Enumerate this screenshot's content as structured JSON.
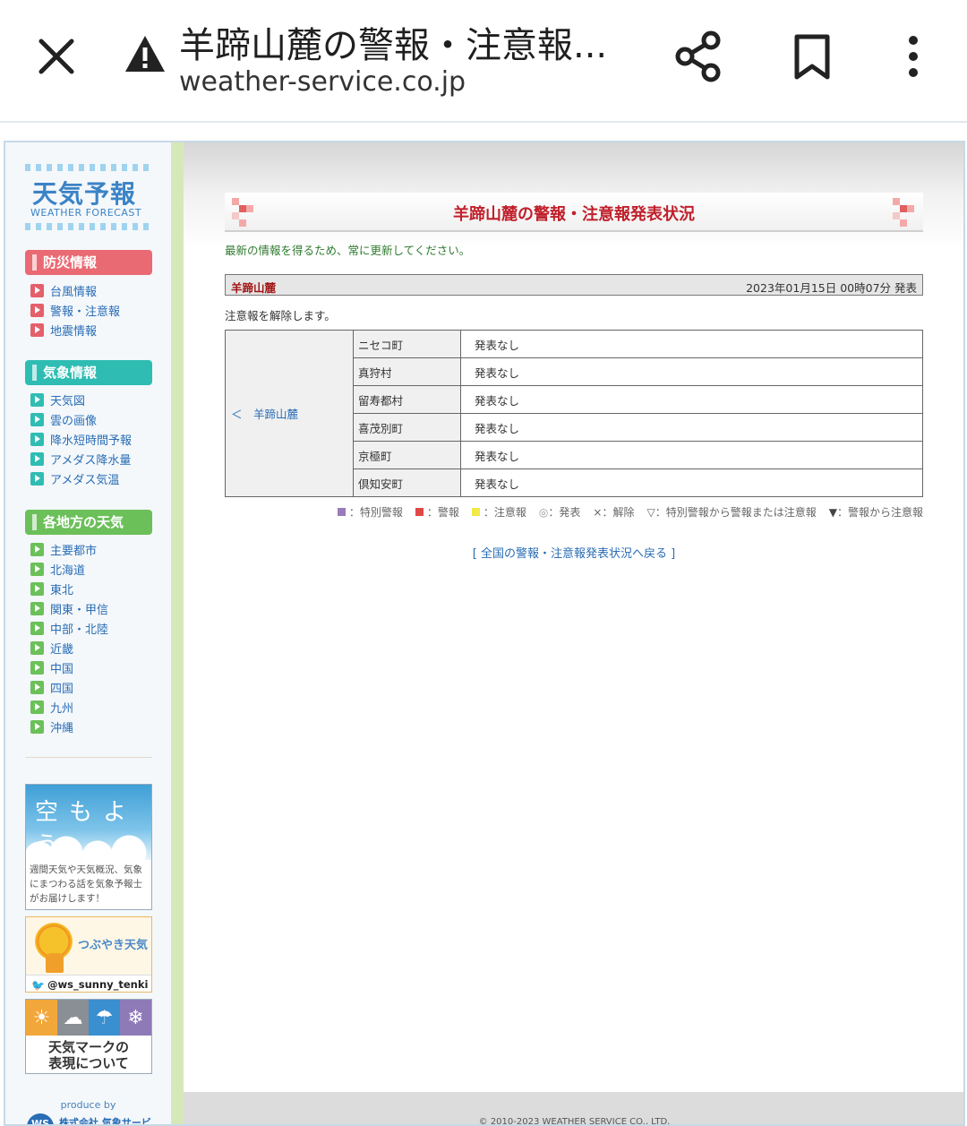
{
  "browser": {
    "title": "羊蹄山麓の警報・注意報...",
    "url": "weather-service.co.jp",
    "icons": {
      "close": "close-icon",
      "warning": "warning-icon",
      "share": "share-icon",
      "bookmark": "bookmark-icon",
      "more": "more-vert-icon"
    }
  },
  "sidebar": {
    "logo_main": "天気予報",
    "logo_sub": "WEATHER FORECAST",
    "sections": [
      {
        "title": "防災情報",
        "color": "#ea6a74",
        "items": [
          "台風情報",
          "警報・注意報",
          "地震情報"
        ]
      },
      {
        "title": "気象情報",
        "color": "#2fbdb3",
        "items": [
          "天気図",
          "雲の画像",
          "降水短時間予報",
          "アメダス降水量",
          "アメダス気温"
        ]
      },
      {
        "title": "各地方の天気",
        "color": "#6cc05a",
        "items": [
          "主要都市",
          "北海道",
          "東北",
          "関東・甲信",
          "中部・北陸",
          "近畿",
          "中国",
          "四国",
          "九州",
          "沖縄"
        ]
      }
    ],
    "banner_sora": {
      "title": "空もよう",
      "text": "週間天気や天気概況、気象にまつわる話を気象予報士がお届けします！"
    },
    "banner_tweet": {
      "title": "つぶやき天気",
      "handle": "@ws_sunny_tenki"
    },
    "banner_marks": {
      "text_line1": "天気マークの",
      "text_line2": "表現について"
    },
    "produce_by": "produce by",
    "company": "株式会社 気象サービス"
  },
  "main": {
    "page_title": "羊蹄山麓の警報・注意報発表状況",
    "notice": "最新の情報を得るため、常に更新してください。",
    "area_name": "羊蹄山麓",
    "issued": "2023年01月15日 00時07分 発表",
    "status_text": "注意報を解除します。",
    "area_link": "＜　羊蹄山麓",
    "towns": [
      {
        "name": "ニセコ町",
        "status": "発表なし"
      },
      {
        "name": "真狩村",
        "status": "発表なし"
      },
      {
        "name": "留寿都村",
        "status": "発表なし"
      },
      {
        "name": "喜茂別町",
        "status": "発表なし"
      },
      {
        "name": "京極町",
        "status": "発表なし"
      },
      {
        "name": "倶知安町",
        "status": "発表なし"
      }
    ],
    "legend": [
      {
        "symbol": "■",
        "label": "：特別警報",
        "color": "#9b7bb8"
      },
      {
        "symbol": "■",
        "label": "：警報",
        "color": "#e04848"
      },
      {
        "symbol": "■",
        "label": "：注意報",
        "color": "#f2e94a"
      },
      {
        "symbol": "◎",
        "label": "：発表",
        "color": "#999999"
      },
      {
        "symbol": "×",
        "label": "：解除",
        "color": "#666666"
      },
      {
        "symbol": "▽",
        "label": "：特別警報から警報または注意報",
        "color": "#666666"
      },
      {
        "symbol": "▼",
        "label": "：警報から注意報",
        "color": "#444444"
      }
    ],
    "back_link": "[ 全国の警報・注意報発表状況へ戻る ]",
    "copyright": "© 2010-2023 WEATHER SERVICE CO., LTD."
  },
  "colors": {
    "title_red": "#c0202b",
    "link_blue": "#2a6db5",
    "notice_green": "#2f7a2f"
  }
}
